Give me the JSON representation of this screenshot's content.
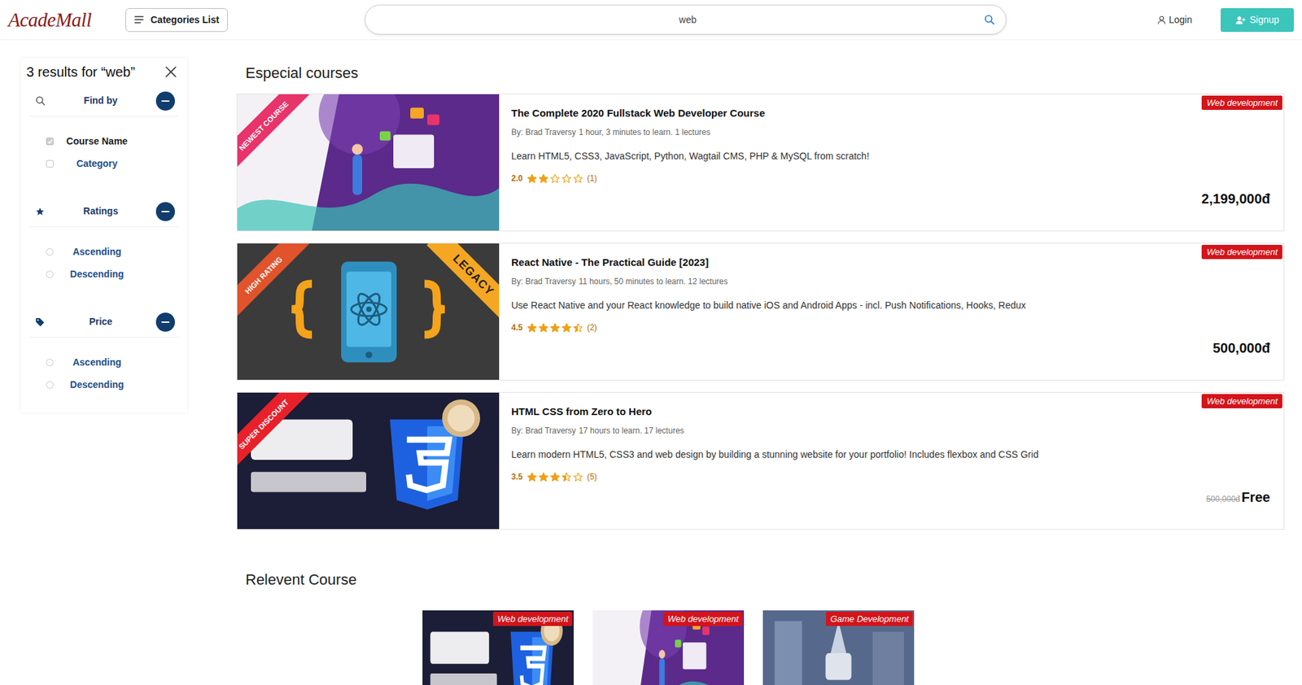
{
  "header": {
    "logo": "AcadeMall",
    "categories_button": "Categories List",
    "search": {
      "value": "web"
    },
    "login": "Login",
    "signup": "Signup"
  },
  "sidebar": {
    "title": "3 results for “web”",
    "sections": [
      {
        "title": "Find by",
        "expanded": true,
        "options": [
          {
            "label": "Course Name",
            "kind": "checkbox",
            "checked": true
          },
          {
            "label": "Category",
            "kind": "checkbox",
            "checked": false
          }
        ]
      },
      {
        "title": "Ratings",
        "expanded": true,
        "options": [
          {
            "label": "Ascending",
            "kind": "radio",
            "selected": false
          },
          {
            "label": "Descending",
            "kind": "radio",
            "selected": false
          }
        ]
      },
      {
        "title": "Price",
        "expanded": true,
        "options": [
          {
            "label": "Ascending",
            "kind": "radio",
            "selected": false
          },
          {
            "label": "Descending",
            "kind": "radio",
            "selected": false
          }
        ]
      }
    ]
  },
  "especial": {
    "title": "Especial courses",
    "courses": [
      {
        "title": "The Complete 2020 Fullstack Web Developer Course",
        "author": "By: Brad Traversy",
        "meta": "1 hour, 3 minutes to learn. 1 lectures",
        "description": "Learn HTML5, CSS3, JavaScript, Python, Wagtail CMS, PHP & MySQL from scratch!",
        "rating": "2.0",
        "stars": 2,
        "reviews": "(1)",
        "price": "2,199,000đ",
        "category": "Web development",
        "thumbnail": {
          "kind": "fullstack",
          "color": "#5b2a8a"
        },
        "ribbons": [
          {
            "text": "NEWEST COURSE",
            "kind": "left",
            "color": "#e8336b",
            "text_color": "#ffffff"
          }
        ]
      },
      {
        "title": "React Native - The Practical Guide [2023]",
        "author": "By: Brad Traversy",
        "meta": "11 hours, 50 minutes to learn. 12 lectures",
        "description": "Use React Native and your React knowledge to build native iOS and Android Apps - incl. Push Notifications, Hooks, Redux",
        "rating": "4.5",
        "stars": 4.5,
        "reviews": "(2)",
        "price": "500,000đ",
        "category": "Web development",
        "thumbnail": {
          "kind": "react",
          "color": "#3b3b3b"
        },
        "ribbons": [
          {
            "text": "HIGH RATING",
            "kind": "left",
            "color": "#e0532b",
            "text_color": "#ffffff"
          },
          {
            "text": "LEGACY",
            "kind": "right",
            "color": "#f5a623",
            "text_color": "#222222"
          }
        ]
      },
      {
        "title": "HTML CSS from Zero to Hero",
        "author": "By: Brad Traversy",
        "meta": "17 hours to learn. 17 lectures",
        "description": "Learn modern HTML5, CSS3 and web design by building a stunning website for your portfolio! Includes flexbox and CSS Grid",
        "rating": "3.5",
        "stars": 3.5,
        "reviews": "(5)",
        "old_price": "500,000đ",
        "price": "Free",
        "category": "Web development",
        "thumbnail": {
          "kind": "css",
          "color": "#1c1d36"
        },
        "ribbons": [
          {
            "text": "SUPER DISCOUNT",
            "kind": "left",
            "color": "#e8202a",
            "text_color": "#ffffff"
          }
        ]
      }
    ]
  },
  "relevant": {
    "title": "Relevent Course",
    "courses": [
      {
        "category": "Web development",
        "thumbnail": {
          "kind": "css",
          "color": "#1c1d36"
        }
      },
      {
        "category": "Web development",
        "thumbnail": {
          "kind": "fullstack",
          "color": "#5b2a8a"
        }
      },
      {
        "category": "Game Development",
        "thumbnail": {
          "kind": "game",
          "color": "#56698c"
        }
      }
    ]
  }
}
